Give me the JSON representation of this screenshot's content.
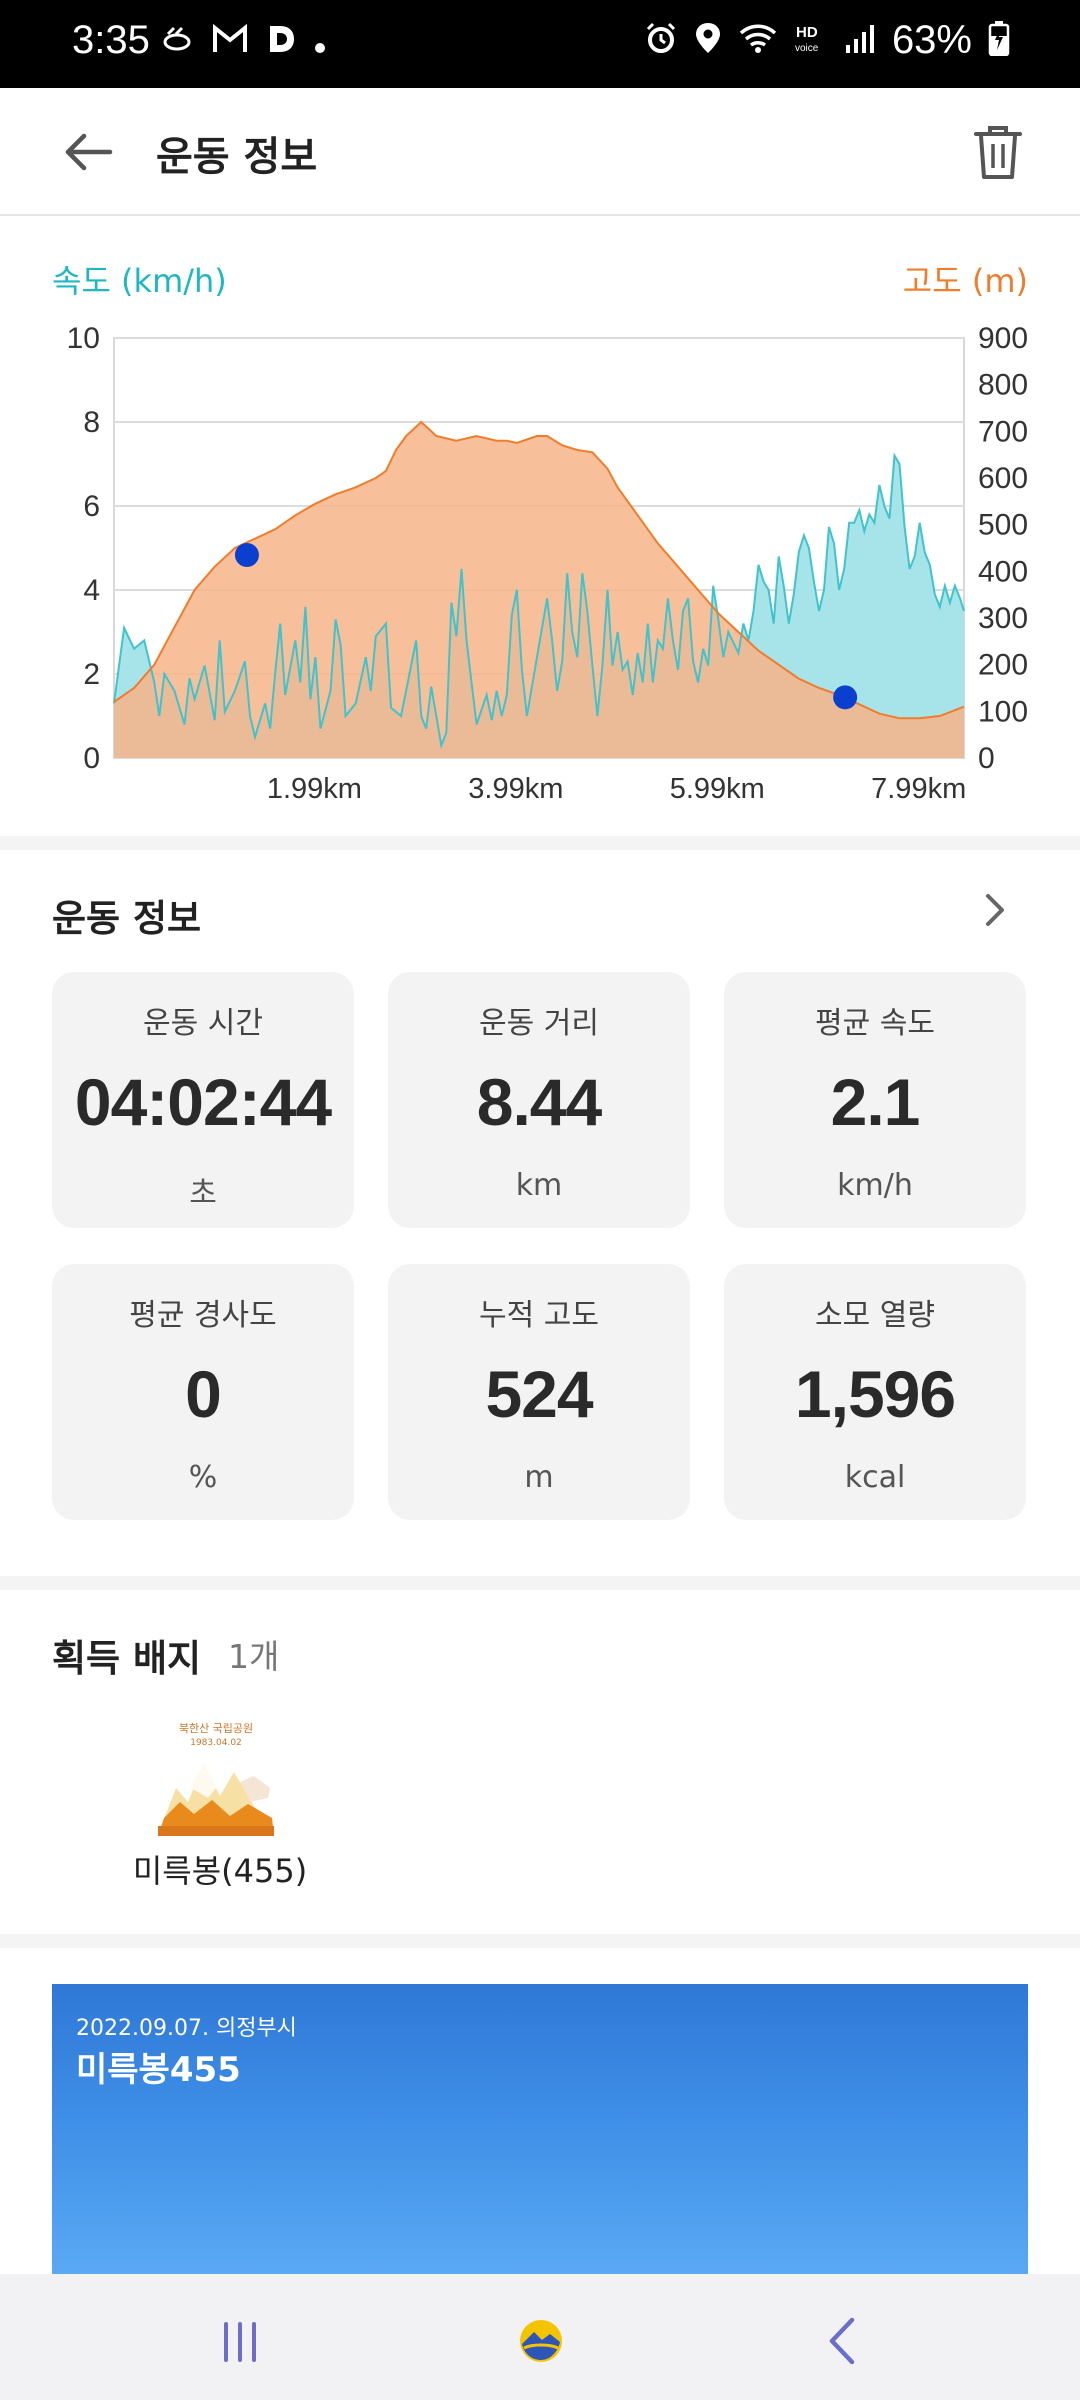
{
  "status_bar": {
    "time": "3:35",
    "battery": "63%",
    "left_icons": [
      "walk-icon",
      "gmail-icon",
      "d-app-icon",
      "dot-icon"
    ],
    "right_icons": [
      "alarm-icon",
      "location-icon",
      "wifi-icon",
      "hd-voice-icon",
      "signal-icon",
      "battery-charging-icon"
    ]
  },
  "header": {
    "title": "운동 정보",
    "back_icon": "arrow-left-icon",
    "trash_icon": "trash-icon"
  },
  "chart": {
    "left_label": "속도 (km/h)",
    "right_label": "고도 (m)"
  },
  "chart_data": {
    "type": "area",
    "xlabel": "",
    "x_ticks": [
      "1.99km",
      "3.99km",
      "5.99km",
      "7.99km"
    ],
    "x_tick_values": [
      1.99,
      3.99,
      5.99,
      7.99
    ],
    "xlim": [
      0,
      8.44
    ],
    "left_axis": {
      "label": "속도 (km/h)",
      "ticks": [
        "0",
        "2",
        "4",
        "6",
        "8",
        "10"
      ],
      "ylim": [
        0,
        10
      ],
      "color": "#1fb7c2"
    },
    "right_axis": {
      "label": "고도 (m)",
      "ticks": [
        "0",
        "100",
        "200",
        "300",
        "400",
        "500",
        "600",
        "700",
        "800",
        "900"
      ],
      "ylim": [
        0,
        900
      ],
      "color": "#ef7d2b"
    },
    "grid": true,
    "series": [
      {
        "name": "속도 (km/h)",
        "axis": "left",
        "color": "#1fb7c2",
        "points": [
          [
            0,
            1.3
          ],
          [
            0.1,
            3.1
          ],
          [
            0.2,
            2.6
          ],
          [
            0.3,
            2.8
          ],
          [
            0.4,
            1.8
          ],
          [
            0.45,
            1.0
          ],
          [
            0.5,
            2.0
          ],
          [
            0.6,
            1.6
          ],
          [
            0.7,
            0.8
          ],
          [
            0.75,
            1.9
          ],
          [
            0.8,
            1.4
          ],
          [
            0.9,
            2.2
          ],
          [
            1.0,
            0.9
          ],
          [
            1.05,
            2.8
          ],
          [
            1.1,
            1.1
          ],
          [
            1.2,
            1.6
          ],
          [
            1.3,
            2.3
          ],
          [
            1.35,
            1.0
          ],
          [
            1.4,
            0.5
          ],
          [
            1.5,
            1.3
          ],
          [
            1.55,
            0.7
          ],
          [
            1.6,
            2.0
          ],
          [
            1.65,
            3.2
          ],
          [
            1.7,
            1.5
          ],
          [
            1.8,
            2.8
          ],
          [
            1.85,
            1.8
          ],
          [
            1.9,
            3.6
          ],
          [
            1.95,
            1.4
          ],
          [
            2.0,
            2.4
          ],
          [
            2.05,
            0.7
          ],
          [
            2.15,
            1.6
          ],
          [
            2.2,
            3.3
          ],
          [
            2.25,
            2.7
          ],
          [
            2.3,
            1.0
          ],
          [
            2.4,
            1.3
          ],
          [
            2.5,
            2.4
          ],
          [
            2.55,
            1.6
          ],
          [
            2.6,
            2.9
          ],
          [
            2.7,
            3.2
          ],
          [
            2.75,
            1.2
          ],
          [
            2.85,
            1.0
          ],
          [
            2.9,
            1.6
          ],
          [
            3.0,
            2.8
          ],
          [
            3.05,
            1.0
          ],
          [
            3.1,
            0.7
          ],
          [
            3.15,
            1.7
          ],
          [
            3.2,
            1.0
          ],
          [
            3.25,
            0.3
          ],
          [
            3.3,
            0.6
          ],
          [
            3.35,
            3.7
          ],
          [
            3.4,
            2.9
          ],
          [
            3.45,
            4.5
          ],
          [
            3.5,
            2.8
          ],
          [
            3.55,
            1.8
          ],
          [
            3.6,
            0.8
          ],
          [
            3.7,
            1.5
          ],
          [
            3.75,
            0.9
          ],
          [
            3.8,
            1.6
          ],
          [
            3.85,
            1.0
          ],
          [
            3.9,
            1.5
          ],
          [
            3.95,
            3.4
          ],
          [
            4.0,
            4.0
          ],
          [
            4.05,
            2.1
          ],
          [
            4.1,
            1.0
          ],
          [
            4.2,
            2.4
          ],
          [
            4.3,
            3.8
          ],
          [
            4.35,
            2.8
          ],
          [
            4.4,
            1.6
          ],
          [
            4.45,
            2.3
          ],
          [
            4.5,
            4.4
          ],
          [
            4.55,
            3.0
          ],
          [
            4.6,
            2.4
          ],
          [
            4.65,
            4.4
          ],
          [
            4.7,
            3.5
          ],
          [
            4.75,
            2.2
          ],
          [
            4.8,
            1.0
          ],
          [
            4.85,
            2.2
          ],
          [
            4.9,
            4.0
          ],
          [
            4.95,
            2.2
          ],
          [
            5.0,
            3.0
          ],
          [
            5.05,
            2.1
          ],
          [
            5.1,
            2.3
          ],
          [
            5.15,
            1.5
          ],
          [
            5.2,
            2.5
          ],
          [
            5.25,
            1.8
          ],
          [
            5.3,
            3.2
          ],
          [
            5.35,
            1.8
          ],
          [
            5.4,
            2.8
          ],
          [
            5.45,
            2.6
          ],
          [
            5.5,
            3.8
          ],
          [
            5.55,
            2.8
          ],
          [
            5.6,
            2.1
          ],
          [
            5.65,
            3.5
          ],
          [
            5.7,
            3.8
          ],
          [
            5.75,
            2.3
          ],
          [
            5.8,
            1.8
          ],
          [
            5.85,
            2.6
          ],
          [
            5.9,
            2.2
          ],
          [
            5.95,
            4.1
          ],
          [
            6.0,
            3.3
          ],
          [
            6.05,
            2.4
          ],
          [
            6.1,
            3.0
          ],
          [
            6.2,
            2.5
          ],
          [
            6.25,
            3.2
          ],
          [
            6.3,
            2.8
          ],
          [
            6.35,
            3.5
          ],
          [
            6.4,
            4.6
          ],
          [
            6.45,
            4.2
          ],
          [
            6.5,
            4.0
          ],
          [
            6.55,
            3.2
          ],
          [
            6.6,
            4.8
          ],
          [
            6.65,
            4.1
          ],
          [
            6.7,
            3.2
          ],
          [
            6.75,
            3.9
          ],
          [
            6.8,
            4.9
          ],
          [
            6.85,
            5.3
          ],
          [
            6.9,
            5.0
          ],
          [
            6.95,
            4.2
          ],
          [
            7.0,
            3.5
          ],
          [
            7.05,
            4.0
          ],
          [
            7.1,
            5.5
          ],
          [
            7.15,
            5.1
          ],
          [
            7.2,
            4.0
          ],
          [
            7.25,
            4.5
          ],
          [
            7.3,
            5.6
          ],
          [
            7.35,
            5.6
          ],
          [
            7.4,
            5.9
          ],
          [
            7.45,
            5.4
          ],
          [
            7.5,
            5.8
          ],
          [
            7.55,
            5.6
          ],
          [
            7.6,
            6.5
          ],
          [
            7.65,
            6.0
          ],
          [
            7.7,
            5.7
          ],
          [
            7.75,
            7.2
          ],
          [
            7.8,
            7.0
          ],
          [
            7.85,
            5.5
          ],
          [
            7.9,
            4.5
          ],
          [
            7.95,
            4.8
          ],
          [
            8.0,
            5.6
          ],
          [
            8.05,
            4.9
          ],
          [
            8.1,
            4.6
          ],
          [
            8.15,
            3.9
          ],
          [
            8.2,
            3.6
          ],
          [
            8.25,
            4.1
          ],
          [
            8.3,
            3.7
          ],
          [
            8.35,
            4.1
          ],
          [
            8.4,
            3.8
          ],
          [
            8.44,
            3.5
          ]
        ]
      },
      {
        "name": "고도 (m)",
        "axis": "right",
        "color": "#ef7d2b",
        "points": [
          [
            0,
            120
          ],
          [
            0.2,
            150
          ],
          [
            0.4,
            200
          ],
          [
            0.6,
            280
          ],
          [
            0.8,
            360
          ],
          [
            1.0,
            410
          ],
          [
            1.2,
            450
          ],
          [
            1.4,
            470
          ],
          [
            1.6,
            490
          ],
          [
            1.8,
            520
          ],
          [
            2.0,
            545
          ],
          [
            2.2,
            565
          ],
          [
            2.4,
            580
          ],
          [
            2.6,
            600
          ],
          [
            2.7,
            615
          ],
          [
            2.8,
            660
          ],
          [
            2.9,
            690
          ],
          [
            3.05,
            720
          ],
          [
            3.2,
            690
          ],
          [
            3.4,
            680
          ],
          [
            3.6,
            690
          ],
          [
            3.8,
            680
          ],
          [
            3.9,
            680
          ],
          [
            4.0,
            675
          ],
          [
            4.2,
            690
          ],
          [
            4.3,
            690
          ],
          [
            4.45,
            670
          ],
          [
            4.6,
            660
          ],
          [
            4.75,
            655
          ],
          [
            4.9,
            620
          ],
          [
            5.0,
            580
          ],
          [
            5.2,
            520
          ],
          [
            5.4,
            460
          ],
          [
            5.6,
            410
          ],
          [
            5.8,
            360
          ],
          [
            6.0,
            310
          ],
          [
            6.2,
            270
          ],
          [
            6.4,
            230
          ],
          [
            6.6,
            200
          ],
          [
            6.8,
            170
          ],
          [
            7.0,
            150
          ],
          [
            7.2,
            135
          ],
          [
            7.4,
            115
          ],
          [
            7.6,
            95
          ],
          [
            7.8,
            85
          ],
          [
            8.0,
            85
          ],
          [
            8.2,
            90
          ],
          [
            8.44,
            110
          ]
        ]
      }
    ],
    "markers": [
      {
        "x": 1.32,
        "axis": "right",
        "y": 435,
        "color": "#0a3fd0"
      },
      {
        "x": 7.26,
        "axis": "right",
        "y": 130,
        "color": "#0a3fd0"
      }
    ]
  },
  "workout": {
    "title": "운동 정보",
    "chevron_icon": "chevron-right-icon",
    "stats": [
      {
        "label": "운동 시간",
        "value": "04:02:44",
        "unit": "초"
      },
      {
        "label": "운동 거리",
        "value": "8.44",
        "unit": "km"
      },
      {
        "label": "평균 속도",
        "value": "2.1",
        "unit": "km/h"
      },
      {
        "label": "평균 경사도",
        "value": "0",
        "unit": "%"
      },
      {
        "label": "누적 고도",
        "value": "524",
        "unit": "m"
      },
      {
        "label": "소모 열량",
        "value": "1,596",
        "unit": "kcal"
      }
    ]
  },
  "badges": {
    "title": "획득 배지",
    "count": "1개",
    "items": [
      {
        "name": "미륵봉(455)",
        "icon": "mountain-badge-icon",
        "emblem_text": [
          "북한산 국립공원",
          "1983.04.02"
        ]
      }
    ]
  },
  "banner": {
    "date_location": "2022.09.07. 의정부시",
    "name": "미륵봉455"
  },
  "nav": {
    "recent_icon": "recent-apps-icon",
    "home_icon": "home-app-icon",
    "back_icon": "nav-back-icon"
  }
}
